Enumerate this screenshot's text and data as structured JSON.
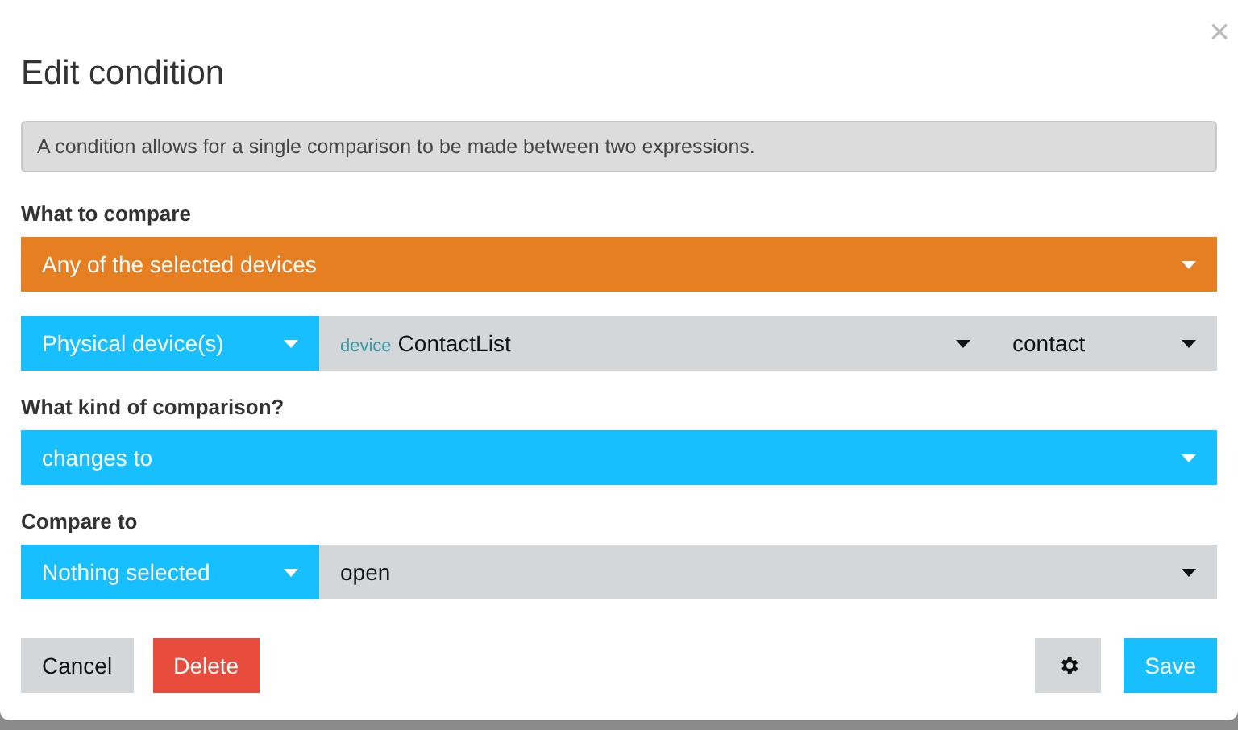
{
  "dialog": {
    "title": "Edit condition",
    "close": "×",
    "info": "A condition allows for a single comparison to be made between two expressions."
  },
  "sections": [
    {
      "label": "What to compare",
      "rows": [
        [
          {
            "kind": "orange",
            "value": "Any of the selected devices"
          }
        ],
        [
          {
            "kind": "blue",
            "value": "Physical device(s)"
          },
          {
            "kind": "gray",
            "prefix": "device",
            "value": "ContactList"
          },
          {
            "kind": "gray",
            "value": "contact"
          }
        ]
      ]
    },
    {
      "label": "What kind of comparison?",
      "rows": [
        [
          {
            "kind": "blue",
            "value": "changes to"
          }
        ]
      ]
    },
    {
      "label": "Compare to",
      "rows": [
        [
          {
            "kind": "blue",
            "value": "Nothing selected"
          },
          {
            "kind": "gray",
            "value": "open"
          }
        ]
      ]
    }
  ],
  "buttons": [
    {
      "kind": "default",
      "label": "Cancel"
    },
    {
      "kind": "danger",
      "label": "Delete"
    },
    {
      "kind": "settings"
    },
    {
      "kind": "primary",
      "label": "Save"
    }
  ]
}
